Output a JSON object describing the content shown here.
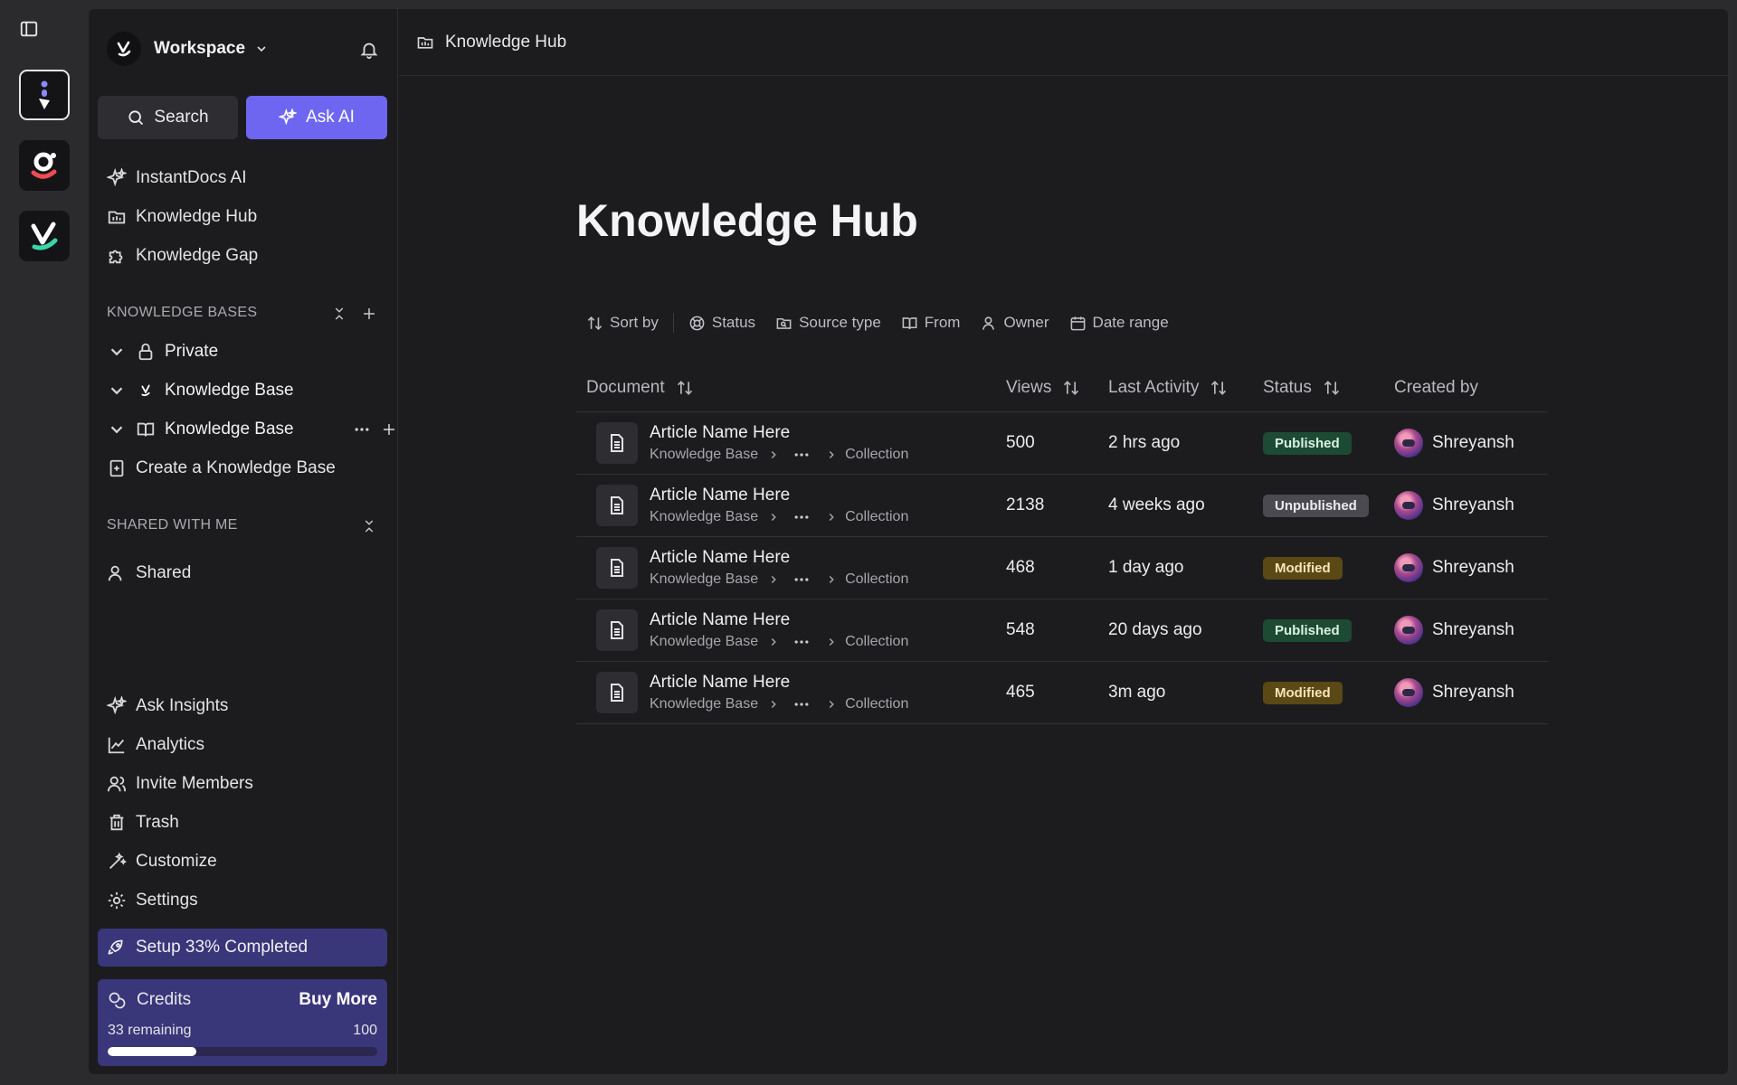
{
  "workspace": {
    "name": "Workspace"
  },
  "buttons": {
    "search": "Search",
    "ask_ai": "Ask AI"
  },
  "nav_top": [
    {
      "label": "InstantDocs AI",
      "icon": "sparkle-icon"
    },
    {
      "label": "Knowledge Hub",
      "icon": "folder-icon"
    },
    {
      "label": "Knowledge Gap",
      "icon": "puzzle-icon"
    }
  ],
  "sections": {
    "knowledge_bases": "KNOWLEDGE BASES",
    "shared_with_me": "SHARED WITH ME"
  },
  "kb_items": [
    {
      "label": "Private",
      "icon": "lock-icon"
    },
    {
      "label": "Knowledge Base",
      "icon": "workspace-logo-icon"
    },
    {
      "label": "Knowledge Base",
      "icon": "book-icon"
    }
  ],
  "create_kb": "Create a Knowledge Base",
  "shared": "Shared",
  "nav_bottom": [
    {
      "label": "Ask Insights",
      "icon": "sparkle-icon"
    },
    {
      "label": "Analytics",
      "icon": "chart-line-icon"
    },
    {
      "label": "Invite Members",
      "icon": "users-icon"
    },
    {
      "label": "Trash",
      "icon": "trash-icon"
    },
    {
      "label": "Customize",
      "icon": "magic-wand-icon"
    },
    {
      "label": "Settings",
      "icon": "gear-icon"
    }
  ],
  "setup": {
    "label": "Setup 33% Completed"
  },
  "credits": {
    "label": "Credits",
    "buy": "Buy More",
    "remaining": "33 remaining",
    "total": "100",
    "fraction": 0.33
  },
  "topbar": {
    "crumb": "Knowledge Hub"
  },
  "page": {
    "title": "Knowledge Hub"
  },
  "filters": [
    "Sort by",
    "Status",
    "Source type",
    "From",
    "Owner",
    "Date range"
  ],
  "table": {
    "headers": {
      "document": "Document",
      "views": "Views",
      "last_activity": "Last Activity",
      "status": "Status",
      "created_by": "Created by"
    },
    "rows": [
      {
        "title": "Article Name Here",
        "kb": "Knowledge Base",
        "collection": "Collection",
        "views": "500",
        "activity": "2 hrs ago",
        "status": "Published",
        "status_kind": "published",
        "by": "Shreyansh"
      },
      {
        "title": "Article Name Here",
        "kb": "Knowledge Base",
        "collection": "Collection",
        "views": "2138",
        "activity": "4 weeks ago",
        "status": "Unpublished",
        "status_kind": "unpublished",
        "by": "Shreyansh"
      },
      {
        "title": "Article Name Here",
        "kb": "Knowledge Base",
        "collection": "Collection",
        "views": "468",
        "activity": "1 day ago",
        "status": "Modified",
        "status_kind": "modified",
        "by": "Shreyansh"
      },
      {
        "title": "Article Name Here",
        "kb": "Knowledge Base",
        "collection": "Collection",
        "views": "548",
        "activity": "20 days ago",
        "status": "Published",
        "status_kind": "published",
        "by": "Shreyansh"
      },
      {
        "title": "Article Name Here",
        "kb": "Knowledge Base",
        "collection": "Collection",
        "views": "465",
        "activity": "3m ago",
        "status": "Modified",
        "status_kind": "modified",
        "by": "Shreyansh"
      }
    ]
  },
  "colors": {
    "accent": "#6e66f0",
    "setup_bg": "#3a367a",
    "published": "#1d4a33",
    "unpublished": "#4a4a50",
    "modified": "#5a4815"
  }
}
